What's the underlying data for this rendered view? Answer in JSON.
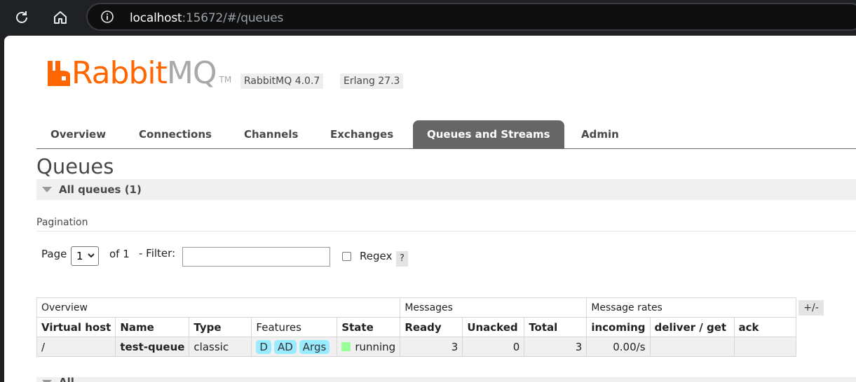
{
  "browser": {
    "url_host": "localhost",
    "url_path": ":15672/#/queues"
  },
  "header": {
    "logo_rabbit": "Rabbit",
    "logo_mq": "MQ",
    "logo_tm": "TM",
    "version": "RabbitMQ 4.0.7",
    "erlang": "Erlang 27.3"
  },
  "tabs": [
    {
      "label": "Overview"
    },
    {
      "label": "Connections"
    },
    {
      "label": "Channels"
    },
    {
      "label": "Exchanges"
    },
    {
      "label": "Queues and Streams",
      "active": true
    },
    {
      "label": "Admin"
    }
  ],
  "page_title": "Queues",
  "section_title": "All queues (1)",
  "pagination": {
    "label": "Pagination",
    "page_label": "Page",
    "page_value": "1",
    "of_label": "of 1",
    "filter_label": "- Filter:",
    "filter_value": "",
    "regex_label": "Regex",
    "help": "?"
  },
  "table": {
    "groups": [
      "Overview",
      "Messages",
      "Message rates"
    ],
    "plus_minus": "+/-",
    "columns": [
      "Virtual host",
      "Name",
      "Type",
      "Features",
      "State",
      "Ready",
      "Unacked",
      "Total",
      "incoming",
      "deliver / get",
      "ack"
    ],
    "rows": [
      {
        "vhost": "/",
        "name": "test-queue",
        "type": "classic",
        "features": [
          "D",
          "AD",
          "Args"
        ],
        "state": "running",
        "ready": "3",
        "unacked": "0",
        "total": "3",
        "incoming": "0.00/s",
        "deliver_get": "",
        "ack": ""
      }
    ]
  },
  "bottom_section": "All"
}
